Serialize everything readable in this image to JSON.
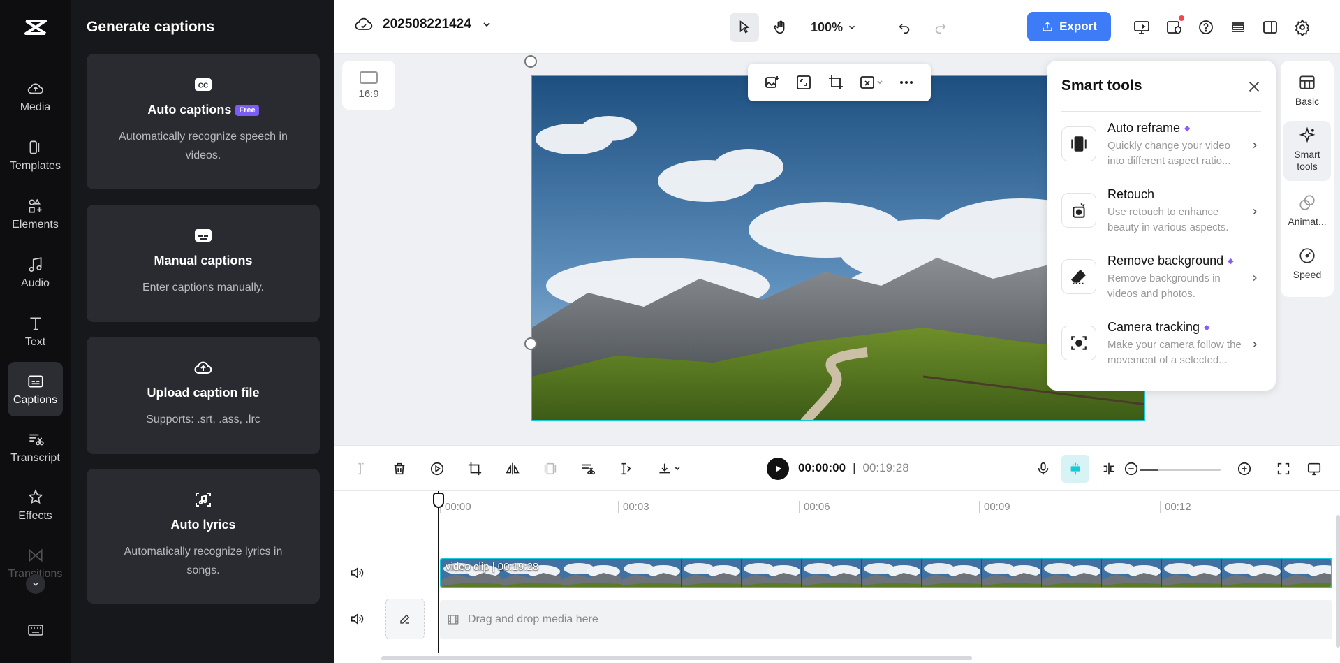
{
  "nav": {
    "items": [
      {
        "label": "Media",
        "icon": "cloud-upload-icon"
      },
      {
        "label": "Templates",
        "icon": "templates-icon"
      },
      {
        "label": "Elements",
        "icon": "elements-icon"
      },
      {
        "label": "Audio",
        "icon": "music-note-icon"
      },
      {
        "label": "Text",
        "icon": "text-icon"
      },
      {
        "label": "Captions",
        "icon": "captions-icon",
        "active": true
      },
      {
        "label": "Transcript",
        "icon": "transcript-icon"
      },
      {
        "label": "Effects",
        "icon": "effects-icon"
      },
      {
        "label": "Transitions",
        "icon": "transitions-icon"
      }
    ]
  },
  "captions_panel": {
    "title": "Generate captions",
    "cards": [
      {
        "title": "Auto captions",
        "badge": "Free",
        "desc": "Automatically recognize speech in videos."
      },
      {
        "title": "Manual captions",
        "desc": "Enter captions manually."
      },
      {
        "title": "Upload caption file",
        "desc": "Supports: .srt, .ass, .lrc"
      },
      {
        "title": "Auto lyrics",
        "desc": "Automatically recognize lyrics in songs."
      }
    ]
  },
  "topbar": {
    "project_name": "202508221424",
    "zoom": "100%",
    "export_label": "Export"
  },
  "canvas": {
    "aspect_ratio": "16:9"
  },
  "smart_tools": {
    "title": "Smart tools",
    "tools": [
      {
        "name": "Auto reframe",
        "desc": "Quickly change your video into different aspect ratio..."
      },
      {
        "name": "Retouch",
        "desc": "Use retouch to enhance beauty in various aspects."
      },
      {
        "name": "Remove background",
        "desc": "Remove backgrounds in videos and photos."
      },
      {
        "name": "Camera tracking",
        "desc": "Make your camera follow the movement of a selected..."
      }
    ]
  },
  "right_tabs": [
    {
      "label": "Basic"
    },
    {
      "label": "Smart tools",
      "active": true
    },
    {
      "label": "Animat..."
    },
    {
      "label": "Speed"
    }
  ],
  "playback": {
    "current": "00:00:00",
    "separator": "|",
    "total": "00:19:28"
  },
  "timeline": {
    "ticks": [
      "00:00",
      "00:03",
      "00:06",
      "00:09",
      "00:12"
    ],
    "clip_label": "video clip",
    "clip_duration": "00:19:28",
    "drop_hint": "Drag and drop media here"
  },
  "colors": {
    "accent": "#18c8d8",
    "export": "#3d7cf6",
    "badge": "#7c5cf6"
  }
}
